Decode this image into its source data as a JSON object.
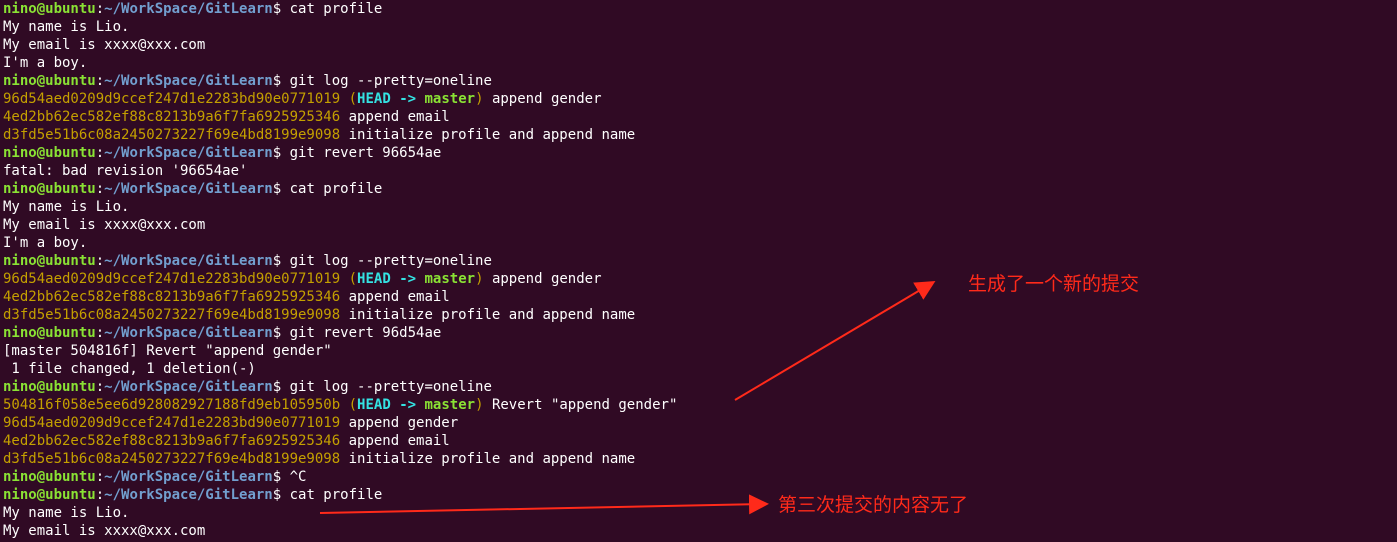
{
  "colors": {
    "background": "#300a24",
    "text": "#ffffff",
    "user_host": "#8ae234",
    "path": "#729fcf",
    "commit_hash": "#c4a000",
    "head_ref": "#34e2e2",
    "branch": "#8ae234",
    "annotation": "#ff2a1a"
  },
  "prompt": {
    "user_host": "nino@ubuntu",
    "colon": ":",
    "path": "~/WorkSpace/GitLearn",
    "dollar": "$ "
  },
  "decoration": {
    "open": "(",
    "head": "HEAD",
    "arrow": "->",
    "branch": "master",
    "close": ")"
  },
  "lines": [
    {
      "kind": "prompt",
      "cmd": "cat profile"
    },
    {
      "kind": "out",
      "text": "My name is Lio."
    },
    {
      "kind": "out",
      "text": "My email is xxxx@xxx.com"
    },
    {
      "kind": "out",
      "text": "I'm a boy."
    },
    {
      "kind": "prompt",
      "cmd": "git log --pretty=oneline"
    },
    {
      "kind": "commit",
      "hash": "96d54aed0209d9ccef247d1e2283bd90e0771019",
      "head": true,
      "msg": "append gender"
    },
    {
      "kind": "commit",
      "hash": "4ed2bb62ec582ef88c8213b9a6f7fa6925925346",
      "head": false,
      "msg": "append email"
    },
    {
      "kind": "commit",
      "hash": "d3fd5e51b6c08a2450273227f69e4bd8199e9098",
      "head": false,
      "msg": "initialize profile and append name"
    },
    {
      "kind": "prompt",
      "cmd": "git revert 96654ae"
    },
    {
      "kind": "out",
      "text": "fatal: bad revision '96654ae'"
    },
    {
      "kind": "prompt",
      "cmd": "cat profile"
    },
    {
      "kind": "out",
      "text": "My name is Lio."
    },
    {
      "kind": "out",
      "text": "My email is xxxx@xxx.com"
    },
    {
      "kind": "out",
      "text": "I'm a boy."
    },
    {
      "kind": "prompt",
      "cmd": "git log --pretty=oneline"
    },
    {
      "kind": "commit",
      "hash": "96d54aed0209d9ccef247d1e2283bd90e0771019",
      "head": true,
      "msg": "append gender"
    },
    {
      "kind": "commit",
      "hash": "4ed2bb62ec582ef88c8213b9a6f7fa6925925346",
      "head": false,
      "msg": "append email"
    },
    {
      "kind": "commit",
      "hash": "d3fd5e51b6c08a2450273227f69e4bd8199e9098",
      "head": false,
      "msg": "initialize profile and append name"
    },
    {
      "kind": "prompt",
      "cmd": "git revert 96d54ae"
    },
    {
      "kind": "out",
      "text": "[master 504816f] Revert \"append gender\""
    },
    {
      "kind": "out",
      "text": " 1 file changed, 1 deletion(-)"
    },
    {
      "kind": "prompt",
      "cmd": "git log --pretty=oneline"
    },
    {
      "kind": "commit",
      "hash": "504816f058e5ee6d928082927188fd9eb105950b",
      "head": true,
      "msg": "Revert \"append gender\""
    },
    {
      "kind": "commit",
      "hash": "96d54aed0209d9ccef247d1e2283bd90e0771019",
      "head": false,
      "msg": "append gender"
    },
    {
      "kind": "commit",
      "hash": "4ed2bb62ec582ef88c8213b9a6f7fa6925925346",
      "head": false,
      "msg": "append email"
    },
    {
      "kind": "commit",
      "hash": "d3fd5e51b6c08a2450273227f69e4bd8199e9098",
      "head": false,
      "msg": "initialize profile and append name"
    },
    {
      "kind": "prompt",
      "cmd": "^C"
    },
    {
      "kind": "prompt",
      "cmd": "cat profile"
    },
    {
      "kind": "out",
      "text": "My name is Lio."
    },
    {
      "kind": "out",
      "text": "My email is xxxx@xxx.com"
    }
  ],
  "annotations": {
    "new_commit": "生成了一个新的提交",
    "third_commit_gone": "第三次提交的内容无了"
  }
}
